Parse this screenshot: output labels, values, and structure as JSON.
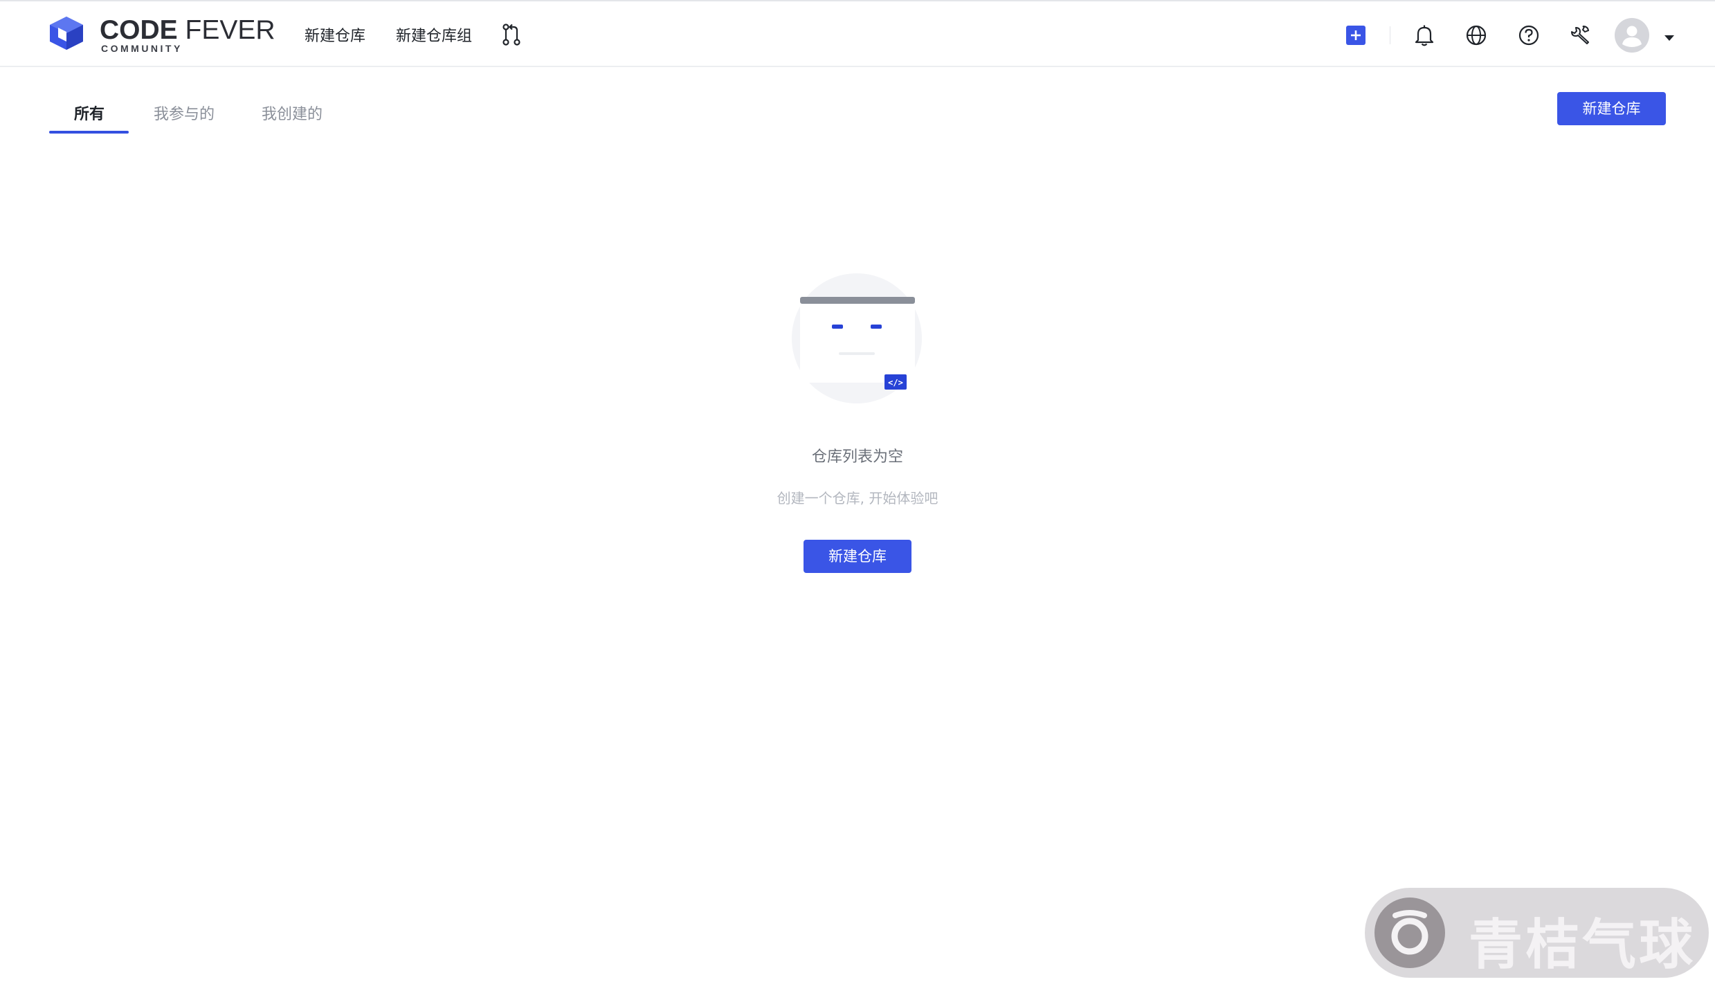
{
  "header": {
    "logo": {
      "brand_bold": "CODE",
      "brand_light": "FEVER",
      "sub": "COMMUNITY",
      "icon": "cube-logo-icon"
    },
    "nav": {
      "new_repo": "新建仓库",
      "new_repo_group": "新建仓库组",
      "merge_request_icon": "git-pull-request-icon"
    },
    "right_icons": [
      "plus-square-icon",
      "bell-icon",
      "globe-icon",
      "help-circle-icon",
      "wrench-icon",
      "avatar-icon",
      "caret-down-icon"
    ]
  },
  "tabs": [
    {
      "label": "所有",
      "active": true
    },
    {
      "label": "我参与的",
      "active": false
    },
    {
      "label": "我创建的",
      "active": false
    }
  ],
  "actions": {
    "new_repo_button": "新建仓库"
  },
  "empty_state": {
    "title": "仓库列表为空",
    "description": "创建一个仓库, 开始体验吧",
    "button": "新建仓库",
    "badge_glyph": "</>"
  },
  "watermark": {
    "text": "青桔气球"
  },
  "colors": {
    "primary": "#3a55e6",
    "text": "#1f2329",
    "muted": "#8a8f99"
  }
}
